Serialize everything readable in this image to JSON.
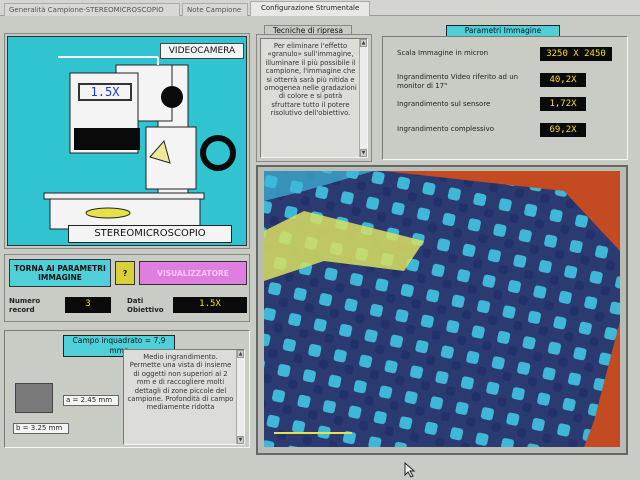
{
  "tabs": [
    {
      "label": "Generalità Campione-STEREOMICROSCOPIO"
    },
    {
      "label": "Note Campione"
    },
    {
      "label": "Configurazione Strumentale"
    }
  ],
  "camera_panel": {
    "videocamera_label": "VIDEOCAMERA",
    "zoom_value": "1.5X",
    "instrument_label": "STEREOMICROSCOPIO"
  },
  "tecniche": {
    "header": "Tecniche di ripresa",
    "text": "Per eliminare l'effetto «granulo» sull'immagine, illuminare il più possibile il campione, l'immagine che si otterrà sarà più nitida e omogenea nelle gradazioni di colore e si potrà sfruttare tutto il potere risolutivo dell'obiettivo."
  },
  "parametri": {
    "header": "Parametri Immagine",
    "rows": [
      {
        "label": "Scala Immagine in micron",
        "value": "3250 X 2450"
      },
      {
        "label": "Ingrandimento Video riferito ad un monitor di 17\"",
        "value": "40,2X"
      },
      {
        "label": "Ingrandimento sul sensore",
        "value": "1,72X"
      },
      {
        "label": "Ingrandimento complessivo",
        "value": "69,2X"
      }
    ]
  },
  "controls": {
    "back_button": "TORNA AI PARAMETRI IMMAGINE",
    "help_button": "?",
    "viewer_button": "VISUALIZZATORE",
    "record_label": "Numero record",
    "record_value": "3",
    "objective_label": "Dati Obiettivo",
    "objective_value": "1.5X"
  },
  "campo": {
    "header": "Campo inquadrato = 7,9 mmq",
    "a_dim": "a = 2.45 mm",
    "b_dim": "b = 3.25 mm",
    "description": "Medio ingrandimento. Permette una vista di insieme di oggetti non superiori ai 2 mm e di raccogliere molti dettagli di zone piccole del campione. Profondità di campo mediamente ridotta"
  },
  "colors": {
    "teal_panel": "#2fc4d0",
    "lcd_text": "#f2e018",
    "viewer_button": "#e07ee0",
    "help_button": "#d8d03a",
    "back_button": "#4fd0d8"
  }
}
